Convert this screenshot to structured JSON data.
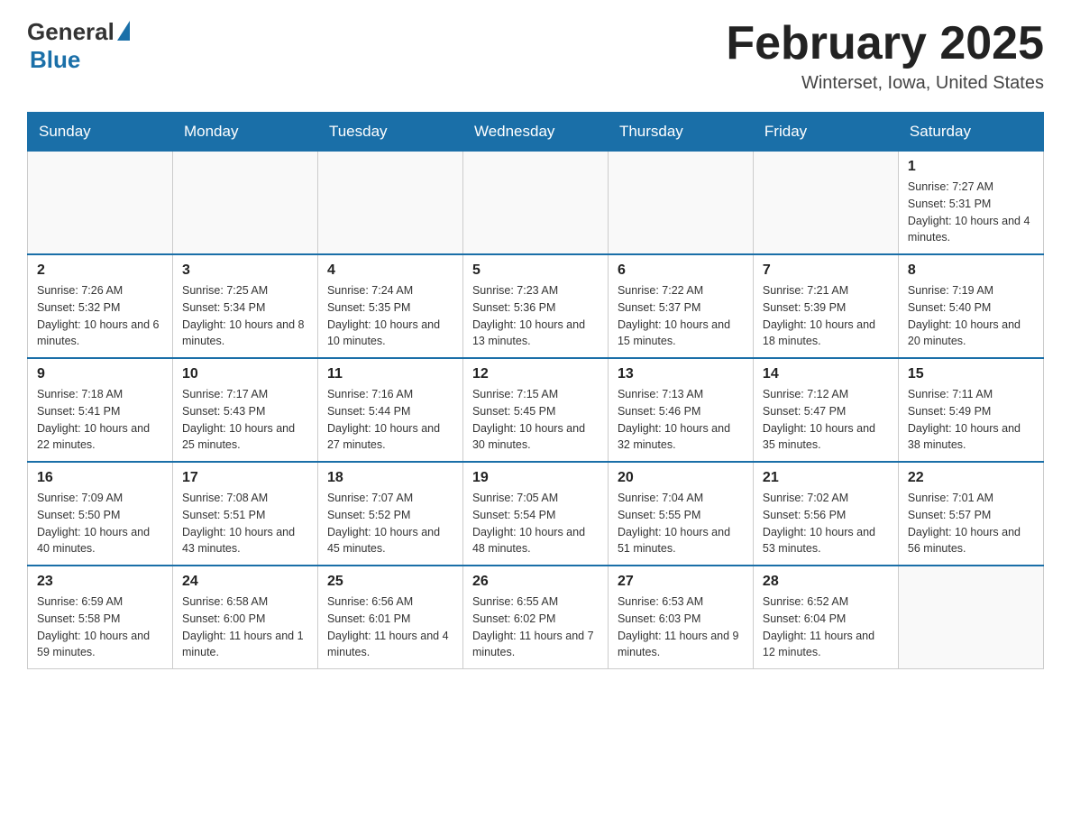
{
  "header": {
    "logo_general": "General",
    "logo_blue": "Blue",
    "month_title": "February 2025",
    "location": "Winterset, Iowa, United States"
  },
  "days_of_week": [
    "Sunday",
    "Monday",
    "Tuesday",
    "Wednesday",
    "Thursday",
    "Friday",
    "Saturday"
  ],
  "weeks": [
    [
      {
        "day": "",
        "info": ""
      },
      {
        "day": "",
        "info": ""
      },
      {
        "day": "",
        "info": ""
      },
      {
        "day": "",
        "info": ""
      },
      {
        "day": "",
        "info": ""
      },
      {
        "day": "",
        "info": ""
      },
      {
        "day": "1",
        "info": "Sunrise: 7:27 AM\nSunset: 5:31 PM\nDaylight: 10 hours and 4 minutes."
      }
    ],
    [
      {
        "day": "2",
        "info": "Sunrise: 7:26 AM\nSunset: 5:32 PM\nDaylight: 10 hours and 6 minutes."
      },
      {
        "day": "3",
        "info": "Sunrise: 7:25 AM\nSunset: 5:34 PM\nDaylight: 10 hours and 8 minutes."
      },
      {
        "day": "4",
        "info": "Sunrise: 7:24 AM\nSunset: 5:35 PM\nDaylight: 10 hours and 10 minutes."
      },
      {
        "day": "5",
        "info": "Sunrise: 7:23 AM\nSunset: 5:36 PM\nDaylight: 10 hours and 13 minutes."
      },
      {
        "day": "6",
        "info": "Sunrise: 7:22 AM\nSunset: 5:37 PM\nDaylight: 10 hours and 15 minutes."
      },
      {
        "day": "7",
        "info": "Sunrise: 7:21 AM\nSunset: 5:39 PM\nDaylight: 10 hours and 18 minutes."
      },
      {
        "day": "8",
        "info": "Sunrise: 7:19 AM\nSunset: 5:40 PM\nDaylight: 10 hours and 20 minutes."
      }
    ],
    [
      {
        "day": "9",
        "info": "Sunrise: 7:18 AM\nSunset: 5:41 PM\nDaylight: 10 hours and 22 minutes."
      },
      {
        "day": "10",
        "info": "Sunrise: 7:17 AM\nSunset: 5:43 PM\nDaylight: 10 hours and 25 minutes."
      },
      {
        "day": "11",
        "info": "Sunrise: 7:16 AM\nSunset: 5:44 PM\nDaylight: 10 hours and 27 minutes."
      },
      {
        "day": "12",
        "info": "Sunrise: 7:15 AM\nSunset: 5:45 PM\nDaylight: 10 hours and 30 minutes."
      },
      {
        "day": "13",
        "info": "Sunrise: 7:13 AM\nSunset: 5:46 PM\nDaylight: 10 hours and 32 minutes."
      },
      {
        "day": "14",
        "info": "Sunrise: 7:12 AM\nSunset: 5:47 PM\nDaylight: 10 hours and 35 minutes."
      },
      {
        "day": "15",
        "info": "Sunrise: 7:11 AM\nSunset: 5:49 PM\nDaylight: 10 hours and 38 minutes."
      }
    ],
    [
      {
        "day": "16",
        "info": "Sunrise: 7:09 AM\nSunset: 5:50 PM\nDaylight: 10 hours and 40 minutes."
      },
      {
        "day": "17",
        "info": "Sunrise: 7:08 AM\nSunset: 5:51 PM\nDaylight: 10 hours and 43 minutes."
      },
      {
        "day": "18",
        "info": "Sunrise: 7:07 AM\nSunset: 5:52 PM\nDaylight: 10 hours and 45 minutes."
      },
      {
        "day": "19",
        "info": "Sunrise: 7:05 AM\nSunset: 5:54 PM\nDaylight: 10 hours and 48 minutes."
      },
      {
        "day": "20",
        "info": "Sunrise: 7:04 AM\nSunset: 5:55 PM\nDaylight: 10 hours and 51 minutes."
      },
      {
        "day": "21",
        "info": "Sunrise: 7:02 AM\nSunset: 5:56 PM\nDaylight: 10 hours and 53 minutes."
      },
      {
        "day": "22",
        "info": "Sunrise: 7:01 AM\nSunset: 5:57 PM\nDaylight: 10 hours and 56 minutes."
      }
    ],
    [
      {
        "day": "23",
        "info": "Sunrise: 6:59 AM\nSunset: 5:58 PM\nDaylight: 10 hours and 59 minutes."
      },
      {
        "day": "24",
        "info": "Sunrise: 6:58 AM\nSunset: 6:00 PM\nDaylight: 11 hours and 1 minute."
      },
      {
        "day": "25",
        "info": "Sunrise: 6:56 AM\nSunset: 6:01 PM\nDaylight: 11 hours and 4 minutes."
      },
      {
        "day": "26",
        "info": "Sunrise: 6:55 AM\nSunset: 6:02 PM\nDaylight: 11 hours and 7 minutes."
      },
      {
        "day": "27",
        "info": "Sunrise: 6:53 AM\nSunset: 6:03 PM\nDaylight: 11 hours and 9 minutes."
      },
      {
        "day": "28",
        "info": "Sunrise: 6:52 AM\nSunset: 6:04 PM\nDaylight: 11 hours and 12 minutes."
      },
      {
        "day": "",
        "info": ""
      }
    ]
  ]
}
